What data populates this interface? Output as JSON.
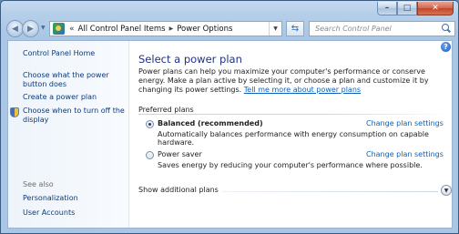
{
  "window": {
    "caption_minimize": "–",
    "caption_maximize": "□",
    "caption_close": "✕"
  },
  "nav": {
    "back_glyph": "◀",
    "forward_glyph": "▶",
    "back_icon": "back-arrow-icon",
    "forward_icon": "forward-arrow-icon"
  },
  "address": {
    "overflow": "«",
    "breadcrumbs": [
      "All Control Panel Items",
      "Power Options"
    ],
    "separator": "▶",
    "dropdown": "▼",
    "refresh_glyph": "⇆"
  },
  "search": {
    "placeholder": "Search Control Panel"
  },
  "sidebar": {
    "home": "Control Panel Home",
    "items": [
      "Choose what the power button does",
      "Create a power plan",
      "Choose when to turn off the display"
    ],
    "see_also_label": "See also",
    "see_also": [
      "Personalization",
      "User Accounts"
    ]
  },
  "main": {
    "help": "?",
    "title": "Select a power plan",
    "intro": "Power plans can help you maximize your computer's performance or conserve energy. Make a plan active by selecting it, or choose a plan and customize it by changing its power settings.",
    "intro_link": "Tell me more about power plans",
    "section": "Preferred plans",
    "plans": [
      {
        "name": "Balanced (recommended)",
        "description": "Automatically balances performance with energy consumption on capable hardware.",
        "change": "Change plan settings",
        "selected": true
      },
      {
        "name": "Power saver",
        "description": "Saves energy by reducing your computer's performance where possible.",
        "change": "Change plan settings",
        "selected": false
      }
    ],
    "show_more": "Show additional plans",
    "expand_glyph": "▼"
  }
}
